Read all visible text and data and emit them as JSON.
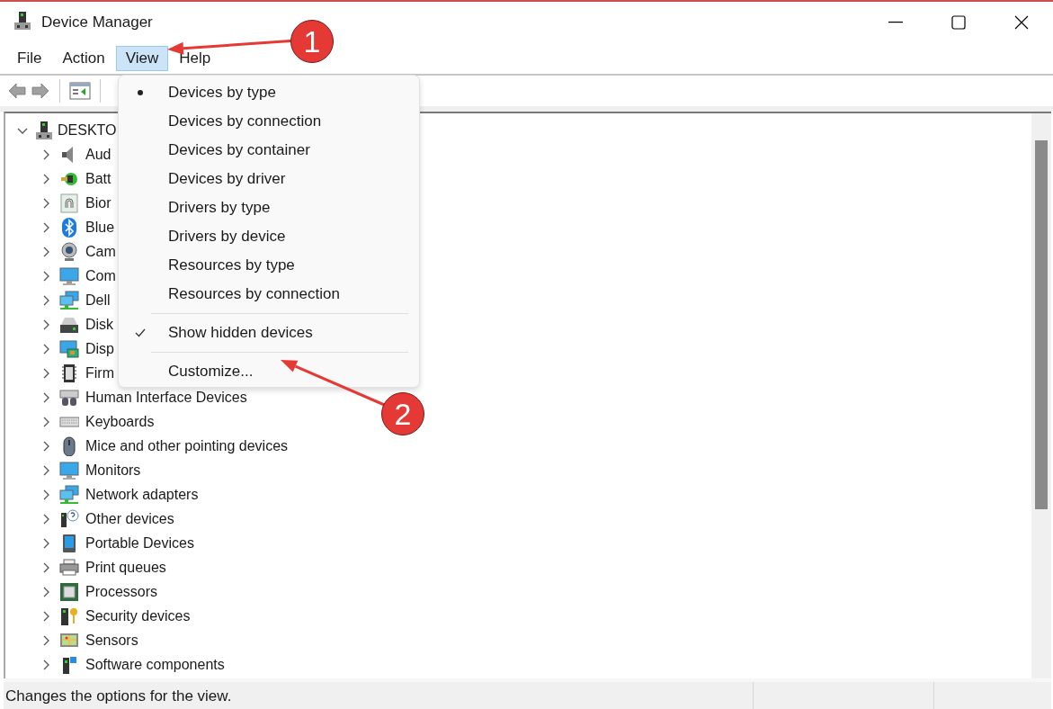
{
  "window": {
    "title": "Device Manager"
  },
  "menu_bar": [
    {
      "label": "File",
      "selected": false
    },
    {
      "label": "Action",
      "selected": false
    },
    {
      "label": "View",
      "selected": true
    },
    {
      "label": "Help",
      "selected": false
    }
  ],
  "toolbar": {
    "back_disabled": true,
    "forward_disabled": true
  },
  "tree": {
    "label": "DESKTO",
    "expanded": true,
    "children": [
      {
        "label": "Aud",
        "expanded": false
      },
      {
        "label": "Batt",
        "expanded": false
      },
      {
        "label": "Bior",
        "expanded": false
      },
      {
        "label": "Blue",
        "expanded": false
      },
      {
        "label": "Cam",
        "expanded": false
      },
      {
        "label": "Com",
        "expanded": false
      },
      {
        "label": "Dell",
        "expanded": false
      },
      {
        "label": "Disk",
        "expanded": false
      },
      {
        "label": "Disp",
        "expanded": false
      },
      {
        "label": "Firm",
        "expanded": false
      },
      {
        "label": "Human Interface Devices",
        "expanded": false
      },
      {
        "label": "Keyboards",
        "expanded": false
      },
      {
        "label": "Mice and other pointing devices",
        "expanded": false
      },
      {
        "label": "Monitors",
        "expanded": false
      },
      {
        "label": "Network adapters",
        "expanded": false
      },
      {
        "label": "Other devices",
        "expanded": false
      },
      {
        "label": "Portable Devices",
        "expanded": false
      },
      {
        "label": "Print queues",
        "expanded": false
      },
      {
        "label": "Processors",
        "expanded": false
      },
      {
        "label": "Security devices",
        "expanded": false
      },
      {
        "label": "Sensors",
        "expanded": false
      },
      {
        "label": "Software components",
        "expanded": false
      }
    ]
  },
  "view_menu": [
    {
      "kind": "radio",
      "label": "Devices by type",
      "selected": true
    },
    {
      "kind": "radio",
      "label": "Devices by connection",
      "selected": false
    },
    {
      "kind": "radio",
      "label": "Devices by container",
      "selected": false
    },
    {
      "kind": "radio",
      "label": "Devices by driver",
      "selected": false
    },
    {
      "kind": "radio",
      "label": "Drivers by type",
      "selected": false
    },
    {
      "kind": "radio",
      "label": "Drivers by device",
      "selected": false
    },
    {
      "kind": "radio",
      "label": "Resources by type",
      "selected": false
    },
    {
      "kind": "radio",
      "label": "Resources by connection",
      "selected": false
    },
    {
      "kind": "separator"
    },
    {
      "kind": "check",
      "label": "Show hidden devices",
      "checked": true
    },
    {
      "kind": "separator"
    },
    {
      "kind": "command",
      "label": "Customize..."
    }
  ],
  "status_bar": {
    "text": "Changes the options for the view."
  },
  "annotations": [
    {
      "number": "1"
    },
    {
      "number": "2"
    }
  ]
}
